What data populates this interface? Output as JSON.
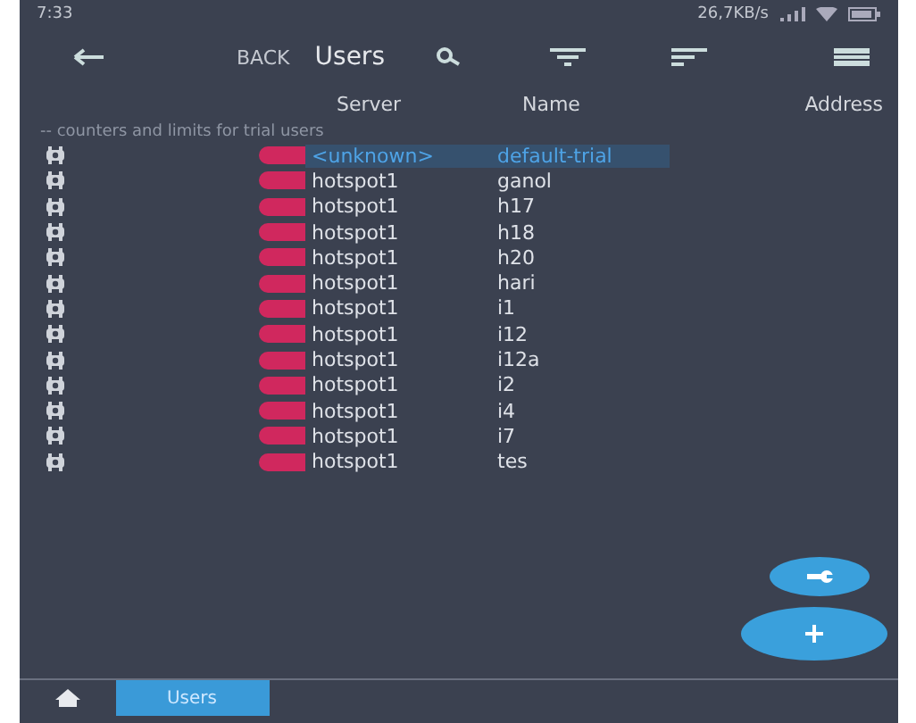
{
  "status_bar": {
    "time": "7:33",
    "speed": "26,7KB/s"
  },
  "toolbar": {
    "back": "BACK",
    "title": "Users"
  },
  "columns": [
    "Server",
    "Name",
    "Address"
  ],
  "comment": "-- counters and limits for trial users",
  "rows": [
    {
      "server": "<unknown>",
      "name": "default-trial",
      "highlighted": true
    },
    {
      "server": "hotspot1",
      "name": "ganol",
      "highlighted": false
    },
    {
      "server": "hotspot1",
      "name": "h17",
      "highlighted": false
    },
    {
      "server": "hotspot1",
      "name": "h18",
      "highlighted": false
    },
    {
      "server": "hotspot1",
      "name": "h20",
      "highlighted": false
    },
    {
      "server": "hotspot1",
      "name": "hari",
      "highlighted": false
    },
    {
      "server": "hotspot1",
      "name": "i1",
      "highlighted": false
    },
    {
      "server": "hotspot1",
      "name": "i12",
      "highlighted": false
    },
    {
      "server": "hotspot1",
      "name": "i12a",
      "highlighted": false
    },
    {
      "server": "hotspot1",
      "name": "i2",
      "highlighted": false
    },
    {
      "server": "hotspot1",
      "name": "i4",
      "highlighted": false
    },
    {
      "server": "hotspot1",
      "name": "i7",
      "highlighted": false
    },
    {
      "server": "hotspot1",
      "name": "tes",
      "highlighted": false
    }
  ],
  "bottom_tabs": [
    {
      "kind": "home",
      "selected": false
    },
    {
      "kind": "text",
      "label": "Users",
      "selected": true
    }
  ]
}
